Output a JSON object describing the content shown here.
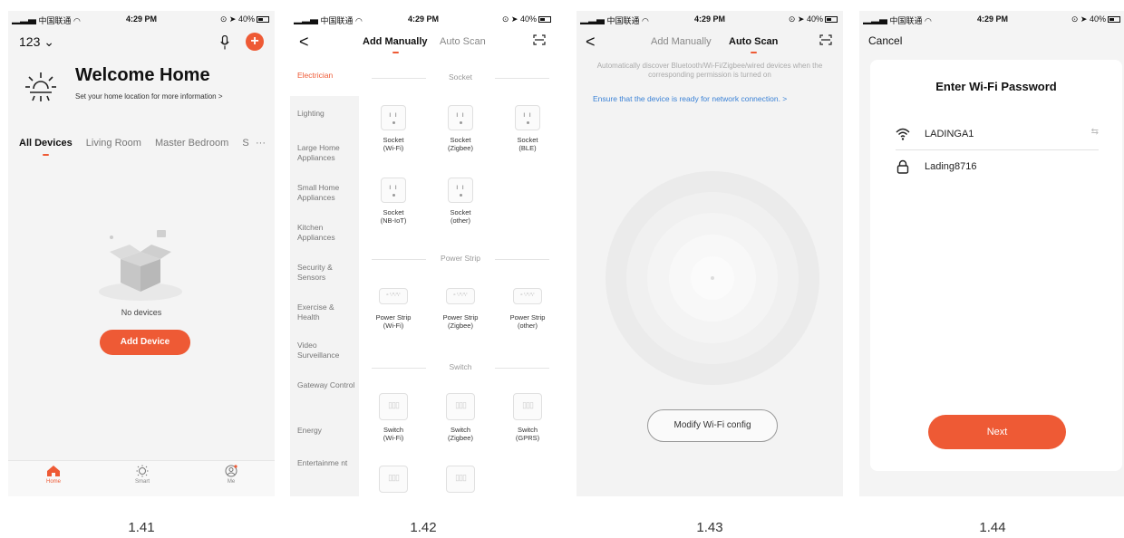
{
  "status_bar": {
    "carrier": "中国联通",
    "time": "4:29 PM",
    "battery": "40%"
  },
  "accent_color": "#ee5a35",
  "link_color": "#3b82d6",
  "screen1": {
    "home_name": "123 ⌄",
    "icons": [
      "microphone-icon",
      "plus-icon",
      "sun-icon",
      "empty-box-icon",
      "home-icon",
      "smart-icon",
      "profile-icon"
    ],
    "welcome_title": "Welcome Home",
    "welcome_sub": "Set your home location for more information >",
    "room_tabs": [
      "All Devices",
      "Living Room",
      "Master Bedroom",
      "S"
    ],
    "more": "···",
    "empty_text": "No devices",
    "add_device": "Add Device",
    "tabbar": [
      "Home",
      "Smart",
      "Me"
    ]
  },
  "screen2": {
    "back": "<",
    "segments": [
      "Add Manually",
      "Auto Scan"
    ],
    "categories": [
      "Electrician",
      "Lighting",
      "Large Home Appliances",
      "Small Home Appliances",
      "Kitchen Appliances",
      "Security & Sensors",
      "Exercise & Health",
      "Video Surveillance",
      "Gateway Control",
      "Energy",
      "Entertainme nt"
    ],
    "sections": [
      "Socket",
      "Power Strip",
      "Switch"
    ],
    "socket_devices": [
      {
        "name": "Socket",
        "sub": "(Wi-Fi)"
      },
      {
        "name": "Socket",
        "sub": "(Zigbee)"
      },
      {
        "name": "Socket",
        "sub": "(BLE)"
      },
      {
        "name": "Socket",
        "sub": "(NB-IoT)"
      },
      {
        "name": "Socket",
        "sub": "(other)"
      }
    ],
    "strip_devices": [
      {
        "name": "Power Strip",
        "sub": "(Wi-Fi)"
      },
      {
        "name": "Power Strip",
        "sub": "(Zigbee)"
      },
      {
        "name": "Power Strip",
        "sub": "(other)"
      }
    ],
    "switch_devices": [
      {
        "name": "Switch",
        "sub": "(Wi-Fi)"
      },
      {
        "name": "Switch",
        "sub": "(Zigbee)"
      },
      {
        "name": "Switch",
        "sub": "(GPRS)"
      }
    ]
  },
  "screen3": {
    "back": "<",
    "segments": [
      "Add Manually",
      "Auto Scan"
    ],
    "description": "Automatically discover Bluetooth/Wi-Fi/Zigbee/wired devices when the corresponding permission is turned on",
    "ready_link": "Ensure that the device is ready for network connection. >",
    "modify_button": "Modify Wi-Fi config"
  },
  "screen4": {
    "cancel": "Cancel",
    "title": "Enter Wi-Fi Password",
    "ssid": "LADINGA1",
    "password": "Lading8716",
    "swap_symbol": "⇆",
    "next": "Next"
  },
  "captions": [
    "1.41",
    "1.42",
    "1.43",
    "1.44"
  ]
}
